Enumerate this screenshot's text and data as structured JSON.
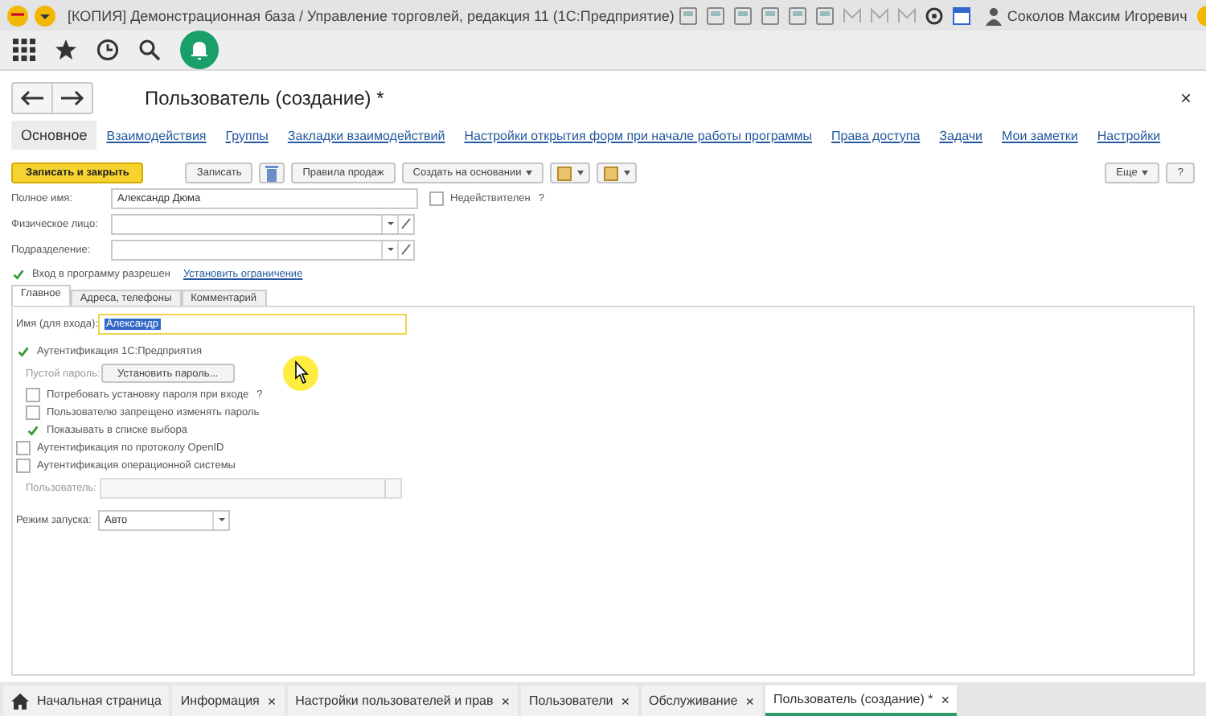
{
  "window": {
    "title": "[КОПИЯ] Демонстрационная база / Управление торговлей, редакция 11  (1С:Предприятие)",
    "user": "Соколов Максим Игоревич"
  },
  "form": {
    "title": "Пользователь (создание) *",
    "close": "×",
    "nav_tabs": [
      {
        "label": "Основное",
        "selected": true
      },
      {
        "label": "Взаимодействия",
        "selected": false
      },
      {
        "label": "Группы",
        "selected": false
      },
      {
        "label": "Закладки взаимодействий",
        "selected": false
      },
      {
        "label": "Настройки открытия форм при начале работы программы",
        "selected": false
      },
      {
        "label": "Права доступа",
        "selected": false
      },
      {
        "label": "Задачи",
        "selected": false
      },
      {
        "label": "Мои заметки",
        "selected": false
      },
      {
        "label": "Настройки",
        "selected": false
      }
    ],
    "commands": [
      {
        "kind": "primary",
        "label": "Записать и закрыть"
      },
      {
        "kind": "plain",
        "label": "Записать"
      },
      {
        "kind": "icon"
      },
      {
        "kind": "plain",
        "label": "Правила продаж"
      },
      {
        "kind": "menu",
        "label": "Создать на основании"
      },
      {
        "kind": "iconmenu"
      },
      {
        "kind": "iconmenu"
      }
    ],
    "more": "Еще",
    "help": "?",
    "full_name": {
      "label": "Полное имя:",
      "value": "Александр Дюма"
    },
    "inactive": {
      "label": "Недействителен",
      "checked": false,
      "hint": "?"
    },
    "lookups": [
      {
        "label": "Физическое лицо:"
      },
      {
        "label": "Подразделение:"
      }
    ],
    "login_allowed": {
      "label": "Вход в программу разрешен",
      "checked": true
    },
    "set_restriction": "Установить ограничение",
    "inner_tabs": [
      {
        "label": "Главное",
        "selected": true
      },
      {
        "label": "Адреса, телефоны",
        "selected": false
      },
      {
        "label": "Комментарий",
        "selected": false
      }
    ],
    "login_name": {
      "label": "Имя (для входа):",
      "value": "Александр"
    },
    "auth_1c": {
      "label": "Аутентификация 1С:Предприятия",
      "checked": true
    },
    "empty_password": "Пустой пароль:",
    "set_password": "Установить пароль...",
    "password_options": [
      {
        "label": "Потребовать установку пароля при входе",
        "checked": false,
        "hint": "?"
      },
      {
        "label": "Пользователю запрещено изменять пароль",
        "checked": false
      },
      {
        "label": "Показывать в списке выбора",
        "checked": true
      }
    ],
    "auth_other": [
      {
        "label": "Аутентификация по протоколу OpenID",
        "checked": false
      },
      {
        "label": "Аутентификация операционной системы",
        "checked": false
      }
    ],
    "os_user": {
      "label": "Пользователь:",
      "disabled": true
    },
    "launch_mode": {
      "label": "Режим запуска:",
      "value": "Авто"
    }
  },
  "open_windows": [
    {
      "kind": "home",
      "label": "Начальная страница",
      "selected": false
    },
    {
      "kind": "window",
      "label": "Информация",
      "selected": false
    },
    {
      "kind": "window",
      "label": "Настройки пользователей и прав",
      "selected": false
    },
    {
      "kind": "window",
      "label": "Пользователи",
      "selected": false
    },
    {
      "kind": "window",
      "label": "Обслуживание",
      "selected": false
    },
    {
      "kind": "window",
      "label": "Пользователь (создание) *",
      "selected": true
    }
  ],
  "tab_close": "×"
}
